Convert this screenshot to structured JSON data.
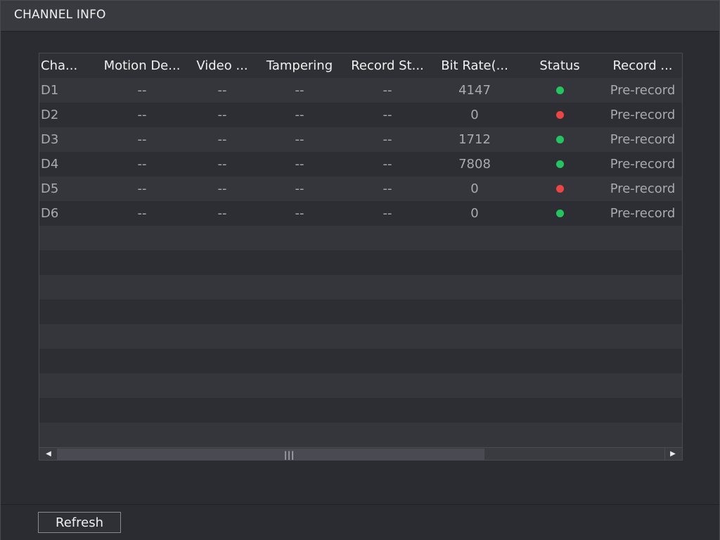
{
  "window": {
    "title": "CHANNEL INFO"
  },
  "table": {
    "headers": [
      "Cha...",
      "Motion De...",
      "Video ...",
      "Tampering",
      "Record St...",
      "Bit Rate(...",
      "Status",
      "Record ..."
    ],
    "rows": [
      {
        "channel": "D1",
        "motion": "--",
        "video": "--",
        "tampering": "--",
        "record_status": "--",
        "bit_rate": "4147",
        "status": "online",
        "record": "Pre-record"
      },
      {
        "channel": "D2",
        "motion": "--",
        "video": "--",
        "tampering": "--",
        "record_status": "--",
        "bit_rate": "0",
        "status": "offline",
        "record": "Pre-record"
      },
      {
        "channel": "D3",
        "motion": "--",
        "video": "--",
        "tampering": "--",
        "record_status": "--",
        "bit_rate": "1712",
        "status": "online",
        "record": "Pre-record"
      },
      {
        "channel": "D4",
        "motion": "--",
        "video": "--",
        "tampering": "--",
        "record_status": "--",
        "bit_rate": "7808",
        "status": "online",
        "record": "Pre-record"
      },
      {
        "channel": "D5",
        "motion": "--",
        "video": "--",
        "tampering": "--",
        "record_status": "--",
        "bit_rate": "0",
        "status": "offline",
        "record": "Pre-record"
      },
      {
        "channel": "D6",
        "motion": "--",
        "video": "--",
        "tampering": "--",
        "record_status": "--",
        "bit_rate": "0",
        "status": "online",
        "record": "Pre-record"
      }
    ],
    "status_colors": {
      "online": "#22c55e",
      "offline": "#ef4444"
    },
    "scrollbar": {
      "left_icon": "triangle-left-icon",
      "right_icon": "triangle-right-icon",
      "grip_icon": "grip-icon",
      "grip": "|||"
    }
  },
  "footer": {
    "refresh_label": "Refresh"
  }
}
